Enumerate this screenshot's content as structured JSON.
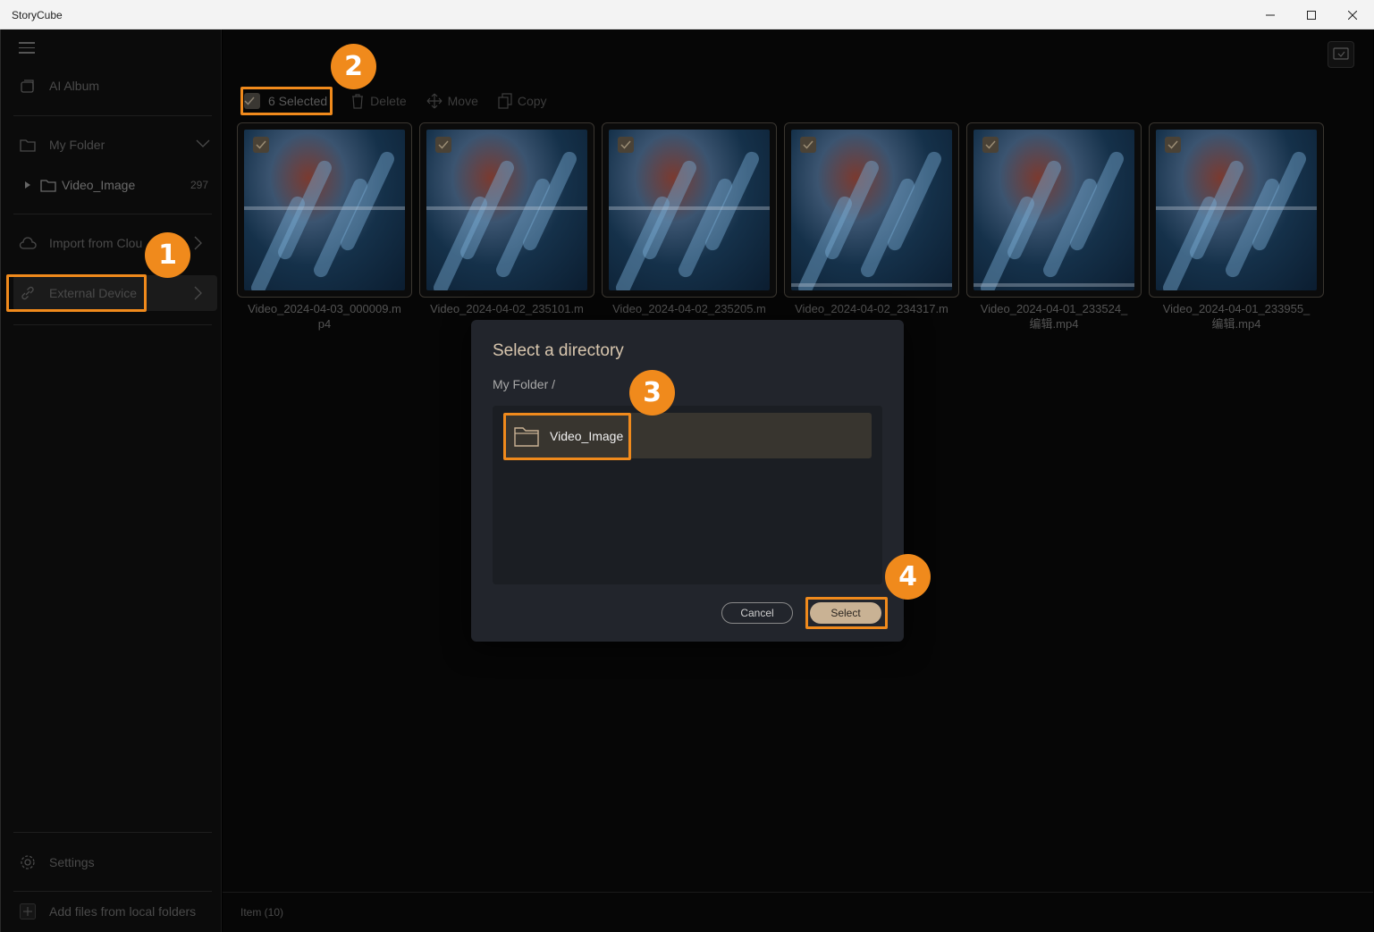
{
  "window": {
    "title": "StoryCube"
  },
  "sidebar": {
    "ai_album": "AI Album",
    "my_folder": "My Folder",
    "sub_folder": {
      "name": "Video_Image",
      "count": "297"
    },
    "import_cloud": "Import from Clou",
    "external_device": "External Device",
    "settings": "Settings",
    "add_files": "Add files from local folders"
  },
  "toolbar": {
    "selected": "6 Selected",
    "delete": "Delete",
    "move": "Move",
    "copy": "Copy"
  },
  "files": [
    {
      "line1": "Video_2024-04-03_000009.m",
      "line2": "p4"
    },
    {
      "line1": "Video_2024-04-02_235101.m",
      "line2": ""
    },
    {
      "line1": "Video_2024-04-02_235205.m",
      "line2": ""
    },
    {
      "line1": "Video_2024-04-02_234317.m",
      "line2": ""
    },
    {
      "line1": "Video_2024-04-01_233524_",
      "line2": "编辑.mp4"
    },
    {
      "line1": "Video_2024-04-01_233955_",
      "line2": "编辑.mp4"
    }
  ],
  "status": {
    "items": "Item (10)"
  },
  "dialog": {
    "title": "Select a directory",
    "breadcrumb": "My Folder  /",
    "folder": "Video_Image",
    "cancel": "Cancel",
    "select": "Select"
  },
  "annotations": [
    "1",
    "2",
    "3",
    "4"
  ],
  "colors": {
    "accent": "#f08a1c",
    "select_button": "#c9b294",
    "dialog_bg": "#22252c"
  }
}
